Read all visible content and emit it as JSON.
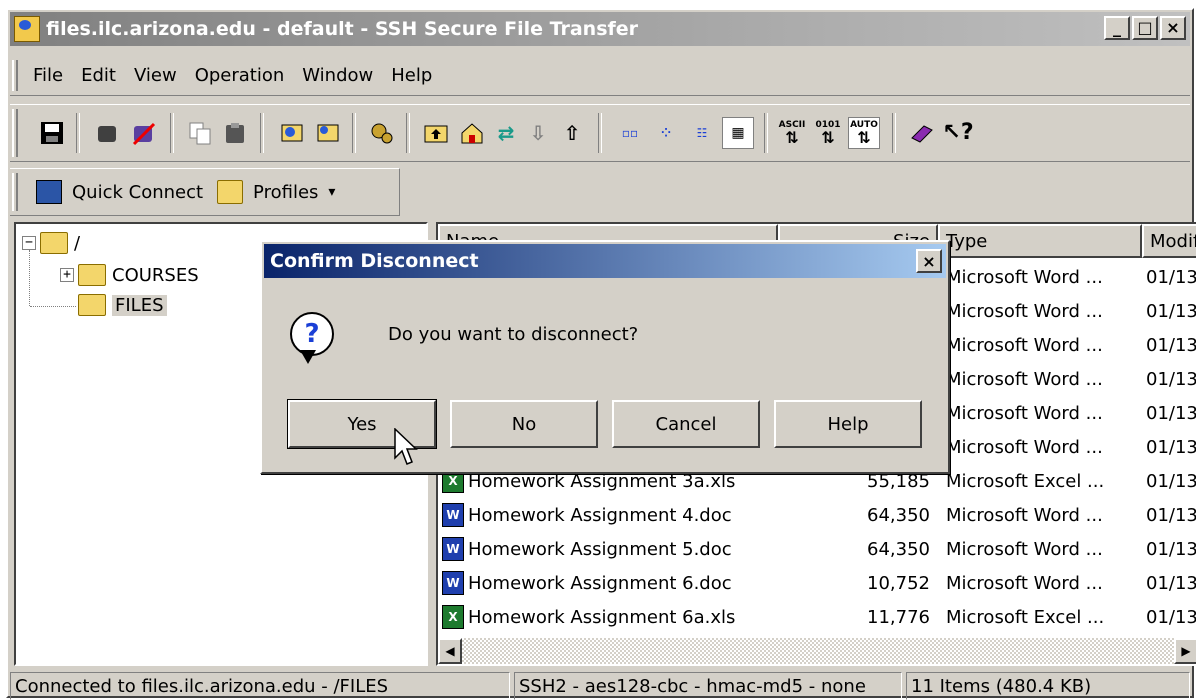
{
  "window": {
    "title": "files.ilc.arizona.edu - default - SSH Secure File Transfer",
    "controls": {
      "minimize": "_",
      "maximize": "□",
      "close": "×"
    }
  },
  "menu": [
    {
      "label": "File"
    },
    {
      "label": "Edit"
    },
    {
      "label": "View"
    },
    {
      "label": "Operation"
    },
    {
      "label": "Window"
    },
    {
      "label": "Help"
    }
  ],
  "toolbar": {
    "icons": [
      "save-icon",
      "connect-icon",
      "disconnect-icon",
      "copy-icon",
      "paste-icon",
      "new-terminal-icon",
      "new-file-transfer-icon",
      "settings-icon",
      "up-folder-icon",
      "home-icon",
      "refresh-icon",
      "download-icon",
      "upload-icon",
      "large-icons-icon",
      "small-icons-icon",
      "list-icon",
      "details-icon",
      "ascii-icon",
      "binary-icon",
      "auto-icon",
      "help-topics-icon",
      "whats-this-icon"
    ],
    "labels": {
      "ascii": "ASCII",
      "binary": "0101",
      "auto": "AUTO"
    }
  },
  "quickbar": {
    "quick_connect": "Quick Connect",
    "profiles": "Profiles",
    "arrow": "▾"
  },
  "tree": {
    "root": "/",
    "nodes": [
      {
        "label": "COURSES",
        "expander": "+"
      },
      {
        "label": "FILES"
      }
    ],
    "root_expander": "−"
  },
  "list": {
    "columns": [
      "Name",
      "Size",
      "Type",
      "Modif"
    ],
    "rows": [
      {
        "name": "",
        "size": "",
        "type": "Microsoft Word ...",
        "modified": "01/13"
      },
      {
        "name": "",
        "size": "",
        "type": "Microsoft Word ...",
        "modified": "01/13"
      },
      {
        "name": "",
        "size": "",
        "type": "Microsoft Word ...",
        "modified": "01/13"
      },
      {
        "name": "",
        "size": "",
        "type": "Microsoft Word ...",
        "modified": "01/13"
      },
      {
        "name": "",
        "size": "",
        "type": "Microsoft Word ...",
        "modified": "01/13"
      },
      {
        "name": "",
        "size": "",
        "type": "Microsoft Word ...",
        "modified": "01/13"
      },
      {
        "name": "Homework Assignment 3a.xls",
        "size": "55,185",
        "type": "Microsoft Excel ...",
        "modified": "01/13",
        "kind": "excel"
      },
      {
        "name": "Homework Assignment 4.doc",
        "size": "64,350",
        "type": "Microsoft Word ...",
        "modified": "01/13",
        "kind": "word"
      },
      {
        "name": "Homework Assignment 5.doc",
        "size": "64,350",
        "type": "Microsoft Word ...",
        "modified": "01/13",
        "kind": "word"
      },
      {
        "name": "Homework Assignment 6.doc",
        "size": "10,752",
        "type": "Microsoft Word ...",
        "modified": "01/13",
        "kind": "word"
      },
      {
        "name": "Homework Assignment 6a.xls",
        "size": "11,776",
        "type": "Microsoft Excel ...",
        "modified": "01/13",
        "kind": "excel"
      }
    ]
  },
  "status": {
    "connection": "Connected to files.ilc.arizona.edu - /FILES",
    "cipher": "SSH2 - aes128-cbc - hmac-md5 - none",
    "items": "11 Items (480.4 KB)"
  },
  "dialog": {
    "title": "Confirm Disconnect",
    "close": "×",
    "message": "Do you want to disconnect?",
    "icon": "question-icon",
    "icon_glyph": "?",
    "buttons": [
      "Yes",
      "No",
      "Cancel",
      "Help"
    ]
  },
  "colors": {
    "dialog_title_start": "#0a246a",
    "dialog_title_end": "#a6caf0",
    "face": "#d4d0c8"
  }
}
